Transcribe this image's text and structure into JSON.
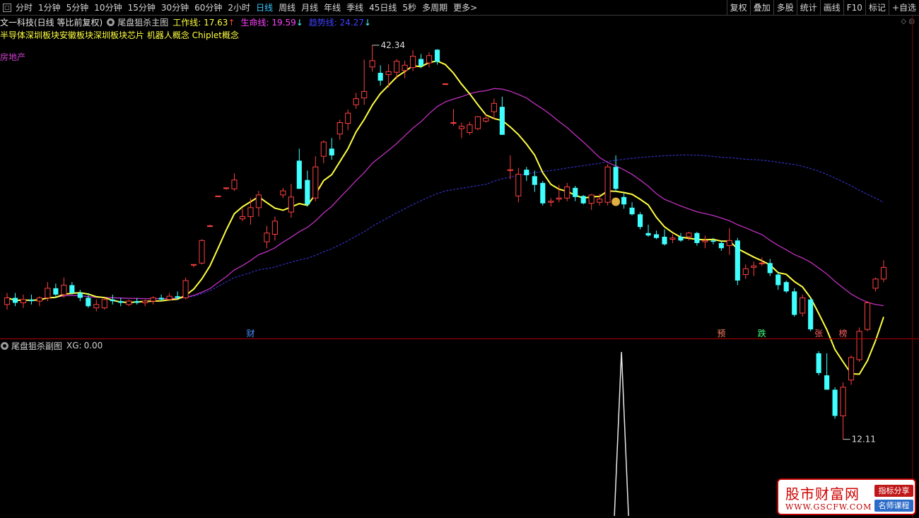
{
  "toolbar": {
    "left_items": [
      "分时",
      "1分钟",
      "5分钟",
      "10分钟",
      "15分钟",
      "30分钟",
      "60分钟",
      "2小时",
      "日线",
      "周线",
      "月线",
      "年线",
      "季线",
      "45日线",
      "5秒",
      "多周期",
      "更多>"
    ],
    "active_item": "日线",
    "right_items": [
      "复权",
      "叠加",
      "多股",
      "统计",
      "画线",
      "F10",
      "标记",
      "+自选"
    ]
  },
  "main_chart": {
    "stock_title": "文一科技(日线 等比前复权)",
    "indicator_name": "尾盘狙杀主图",
    "work_line": {
      "label": "工作线:",
      "value": "17.63",
      "arrow": "↑"
    },
    "life_line": {
      "label": "生命线:",
      "value": "19.59",
      "arrow": "↓"
    },
    "trend_line": {
      "label": "趋势线:",
      "value": "24.27",
      "arrow": "↓"
    },
    "concepts": "半导体深圳板块安徽板块深圳板块芯片 机器人概念 Chiplet概念",
    "sector_tag": "房地产",
    "high_label": "42.34",
    "low_label": "12.11",
    "event_labels": [
      "财",
      "预",
      "跌",
      "张",
      "榜"
    ],
    "corner_icons": "◇ ◎"
  },
  "sub_chart": {
    "indicator_name": "尾盘狙杀副图",
    "xg_label": "XG:",
    "xg_value": "0.00"
  },
  "watermark": {
    "title": "股市财富网",
    "url": "WWW.GSCFW.COM",
    "tag1": "指标分享",
    "tag2": "名师课程"
  },
  "colors": {
    "up": "#ff4040",
    "down": "#40ffff",
    "work_line": "#ffff40",
    "life_line": "#c030c0",
    "trend_line": "#3030c0"
  },
  "chart_data": {
    "type": "candlestick",
    "price_high": 42.34,
    "price_low": 12.11,
    "candles": [
      {
        "o": 13.2,
        "h": 13.9,
        "l": 12.9,
        "c": 13.6
      },
      {
        "o": 13.6,
        "h": 13.9,
        "l": 13.1,
        "c": 13.3
      },
      {
        "o": 13.3,
        "h": 13.8,
        "l": 13.0,
        "c": 13.5
      },
      {
        "o": 13.5,
        "h": 13.8,
        "l": 13.2,
        "c": 13.4
      },
      {
        "o": 13.4,
        "h": 13.7,
        "l": 13.1,
        "c": 13.6
      },
      {
        "o": 13.6,
        "h": 14.6,
        "l": 13.4,
        "c": 14.2
      },
      {
        "o": 14.2,
        "h": 14.5,
        "l": 13.6,
        "c": 13.8
      },
      {
        "o": 13.8,
        "h": 14.9,
        "l": 13.6,
        "c": 14.4
      },
      {
        "o": 14.4,
        "h": 14.6,
        "l": 13.8,
        "c": 13.9
      },
      {
        "o": 13.9,
        "h": 14.1,
        "l": 13.4,
        "c": 13.6
      },
      {
        "o": 13.6,
        "h": 13.9,
        "l": 13.0,
        "c": 13.1
      },
      {
        "o": 13.0,
        "h": 13.5,
        "l": 12.8,
        "c": 13.2
      },
      {
        "o": 13.0,
        "h": 13.6,
        "l": 12.9,
        "c": 13.5
      },
      {
        "o": 13.5,
        "h": 13.8,
        "l": 13.2,
        "c": 13.4
      },
      {
        "o": 13.4,
        "h": 13.6,
        "l": 13.1,
        "c": 13.3
      },
      {
        "o": 13.2,
        "h": 13.5,
        "l": 13.1,
        "c": 13.4
      },
      {
        "o": 13.4,
        "h": 13.6,
        "l": 13.2,
        "c": 13.3
      },
      {
        "o": 13.3,
        "h": 13.5,
        "l": 13.1,
        "c": 13.4
      },
      {
        "o": 13.4,
        "h": 13.7,
        "l": 13.2,
        "c": 13.6
      },
      {
        "o": 13.6,
        "h": 13.8,
        "l": 13.4,
        "c": 13.5
      },
      {
        "o": 13.5,
        "h": 13.9,
        "l": 13.4,
        "c": 13.7
      },
      {
        "o": 13.7,
        "h": 14.0,
        "l": 13.5,
        "c": 13.6
      },
      {
        "o": 13.6,
        "h": 14.9,
        "l": 13.5,
        "c": 14.7
      },
      {
        "o": 15.8,
        "h": 15.8,
        "l": 15.6,
        "c": 15.8
      },
      {
        "o": 15.9,
        "h": 17.7,
        "l": 15.8,
        "c": 17.6
      },
      {
        "o": 18.8,
        "h": 18.9,
        "l": 18.7,
        "c": 18.8
      },
      {
        "o": 21.5,
        "h": 21.5,
        "l": 21.4,
        "c": 21.5
      },
      {
        "o": 22.3,
        "h": 22.3,
        "l": 22.1,
        "c": 22.3
      },
      {
        "o": 22.2,
        "h": 23.8,
        "l": 22.0,
        "c": 23.1
      },
      {
        "o": 19.4,
        "h": 20.3,
        "l": 19.2,
        "c": 19.6
      },
      {
        "o": 19.6,
        "h": 21.3,
        "l": 18.9,
        "c": 20.4
      },
      {
        "o": 20.4,
        "h": 22.0,
        "l": 19.6,
        "c": 21.6
      },
      {
        "o": 17.5,
        "h": 18.8,
        "l": 17.0,
        "c": 18.2
      },
      {
        "o": 18.1,
        "h": 19.6,
        "l": 17.6,
        "c": 19.2
      },
      {
        "o": 21.6,
        "h": 22.3,
        "l": 21.3,
        "c": 22.0
      },
      {
        "o": 20.0,
        "h": 22.7,
        "l": 19.5,
        "c": 21.4
      },
      {
        "o": 25.2,
        "h": 26.6,
        "l": 24.0,
        "c": 22.2
      },
      {
        "o": 23.1,
        "h": 24.1,
        "l": 20.5,
        "c": 20.7
      },
      {
        "o": 21.3,
        "h": 25.7,
        "l": 21.0,
        "c": 24.5
      },
      {
        "o": 25.7,
        "h": 27.6,
        "l": 24.9,
        "c": 27.4
      },
      {
        "o": 26.6,
        "h": 27.9,
        "l": 25.3,
        "c": 25.8
      },
      {
        "o": 28.4,
        "h": 30.3,
        "l": 27.7,
        "c": 29.9
      },
      {
        "o": 29.8,
        "h": 31.7,
        "l": 28.9,
        "c": 31.2
      },
      {
        "o": 32.4,
        "h": 34.2,
        "l": 31.8,
        "c": 33.3
      },
      {
        "o": 33.4,
        "h": 39.7,
        "l": 32.4,
        "c": 34.4
      },
      {
        "o": 38.4,
        "h": 42.34,
        "l": 37.6,
        "c": 39.5
      },
      {
        "o": 37.4,
        "h": 38.7,
        "l": 35.3,
        "c": 36.1
      },
      {
        "o": 37.1,
        "h": 38.9,
        "l": 35.0,
        "c": 37.6
      },
      {
        "o": 37.5,
        "h": 39.8,
        "l": 36.4,
        "c": 39.4
      },
      {
        "o": 37.8,
        "h": 39.5,
        "l": 36.5,
        "c": 38.7
      },
      {
        "o": 38.3,
        "h": 41.4,
        "l": 37.7,
        "c": 40.3
      },
      {
        "o": 39.8,
        "h": 40.7,
        "l": 38.2,
        "c": 38.6
      },
      {
        "o": 39.1,
        "h": 41.0,
        "l": 38.3,
        "c": 40.4
      },
      {
        "o": 41.5,
        "h": 41.6,
        "l": 38.8,
        "c": 39.3
      },
      {
        "o": 35.6,
        "h": 35.6,
        "l": 35.4,
        "c": 35.6
      },
      {
        "o": 29.8,
        "h": 31.8,
        "l": 29.5,
        "c": 29.9
      },
      {
        "o": 29.1,
        "h": 29.9,
        "l": 27.9,
        "c": 29.4
      },
      {
        "o": 28.6,
        "h": 30.0,
        "l": 28.3,
        "c": 29.6
      },
      {
        "o": 29.1,
        "h": 30.8,
        "l": 28.9,
        "c": 30.7
      },
      {
        "o": 30.1,
        "h": 31.1,
        "l": 29.9,
        "c": 30.5
      },
      {
        "o": 31.4,
        "h": 33.3,
        "l": 30.3,
        "c": 32.6
      },
      {
        "o": 32.1,
        "h": 33.6,
        "l": 31.4,
        "c": 28.3
      },
      {
        "o": 24.1,
        "h": 25.8,
        "l": 23.2,
        "c": 24.2
      },
      {
        "o": 21.5,
        "h": 24.4,
        "l": 20.9,
        "c": 23.7
      },
      {
        "o": 24.2,
        "h": 24.5,
        "l": 23.0,
        "c": 23.6
      },
      {
        "o": 23.5,
        "h": 24.1,
        "l": 21.9,
        "c": 22.6
      },
      {
        "o": 22.8,
        "h": 23.0,
        "l": 20.6,
        "c": 20.8
      },
      {
        "o": 20.9,
        "h": 21.3,
        "l": 20.5,
        "c": 21.0
      },
      {
        "o": 21.2,
        "h": 22.6,
        "l": 20.9,
        "c": 21.3
      },
      {
        "o": 21.3,
        "h": 22.8,
        "l": 21.0,
        "c": 22.4
      },
      {
        "o": 22.3,
        "h": 22.5,
        "l": 21.0,
        "c": 21.4
      },
      {
        "o": 21.5,
        "h": 21.6,
        "l": 20.7,
        "c": 20.8
      },
      {
        "o": 20.8,
        "h": 21.7,
        "l": 20.2,
        "c": 21.6
      },
      {
        "o": 20.9,
        "h": 21.7,
        "l": 20.6,
        "c": 21.2
      },
      {
        "o": 20.9,
        "h": 24.8,
        "l": 20.6,
        "c": 24.5
      },
      {
        "o": 24.5,
        "h": 25.8,
        "l": 21.9,
        "c": 22.2
      },
      {
        "o": 21.4,
        "h": 21.8,
        "l": 20.3,
        "c": 20.7
      },
      {
        "o": 20.4,
        "h": 20.9,
        "l": 19.7,
        "c": 19.8
      },
      {
        "o": 19.8,
        "h": 20.0,
        "l": 18.5,
        "c": 18.7
      },
      {
        "o": 18.2,
        "h": 18.9,
        "l": 17.9,
        "c": 18.0
      },
      {
        "o": 18.1,
        "h": 18.4,
        "l": 17.7,
        "c": 17.8
      },
      {
        "o": 17.9,
        "h": 18.5,
        "l": 17.2,
        "c": 17.3
      },
      {
        "o": 17.7,
        "h": 18.1,
        "l": 17.4,
        "c": 17.8
      },
      {
        "o": 17.9,
        "h": 18.2,
        "l": 17.5,
        "c": 17.6
      },
      {
        "o": 17.9,
        "h": 18.3,
        "l": 17.6,
        "c": 18.2
      },
      {
        "o": 18.2,
        "h": 18.3,
        "l": 17.2,
        "c": 17.4
      },
      {
        "o": 17.5,
        "h": 18.0,
        "l": 17.0,
        "c": 17.6
      },
      {
        "o": 17.6,
        "h": 17.8,
        "l": 17.3,
        "c": 17.5
      },
      {
        "o": 17.4,
        "h": 17.6,
        "l": 16.8,
        "c": 17.0
      },
      {
        "o": 17.2,
        "h": 18.6,
        "l": 16.5,
        "c": 17.6
      },
      {
        "o": 17.6,
        "h": 17.8,
        "l": 14.4,
        "c": 14.7
      },
      {
        "o": 15.1,
        "h": 15.8,
        "l": 14.8,
        "c": 15.5
      },
      {
        "o": 15.6,
        "h": 16.0,
        "l": 15.0,
        "c": 15.7
      },
      {
        "o": 15.9,
        "h": 16.3,
        "l": 15.7,
        "c": 15.9
      },
      {
        "o": 15.9,
        "h": 16.2,
        "l": 15.0,
        "c": 15.2
      },
      {
        "o": 15.1,
        "h": 15.3,
        "l": 14.1,
        "c": 14.4
      },
      {
        "o": 14.6,
        "h": 14.7,
        "l": 13.9,
        "c": 14.0
      },
      {
        "o": 14.0,
        "h": 14.2,
        "l": 12.5,
        "c": 12.6
      },
      {
        "o": 12.7,
        "h": 13.8,
        "l": 12.5,
        "c": 13.6
      },
      {
        "o": 13.5,
        "h": 13.6,
        "l": 11.7,
        "c": 11.8
      },
      {
        "o": 10.6,
        "h": 10.7,
        "l": 9.6,
        "c": 9.7
      },
      {
        "o": 9.6,
        "h": 10.6,
        "l": 9.0,
        "c": 9.0
      },
      {
        "o": 9.0,
        "h": 9.1,
        "l": 7.9,
        "c": 8.0
      },
      {
        "o": 8.0,
        "h": 9.3,
        "l": 7.2,
        "c": 9.1
      },
      {
        "o": 9.4,
        "h": 10.5,
        "l": 9.2,
        "c": 10.4
      },
      {
        "o": 10.3,
        "h": 11.9,
        "l": 10.2,
        "c": 11.7
      },
      {
        "o": 11.8,
        "h": 13.4,
        "l": 11.7,
        "c": 13.3
      },
      {
        "o": 14.2,
        "h": 14.9,
        "l": 14.0,
        "c": 14.8
      },
      {
        "o": 14.8,
        "h": 16.1,
        "l": 14.6,
        "c": 15.6
      }
    ],
    "xg_spike_index": 75
  }
}
